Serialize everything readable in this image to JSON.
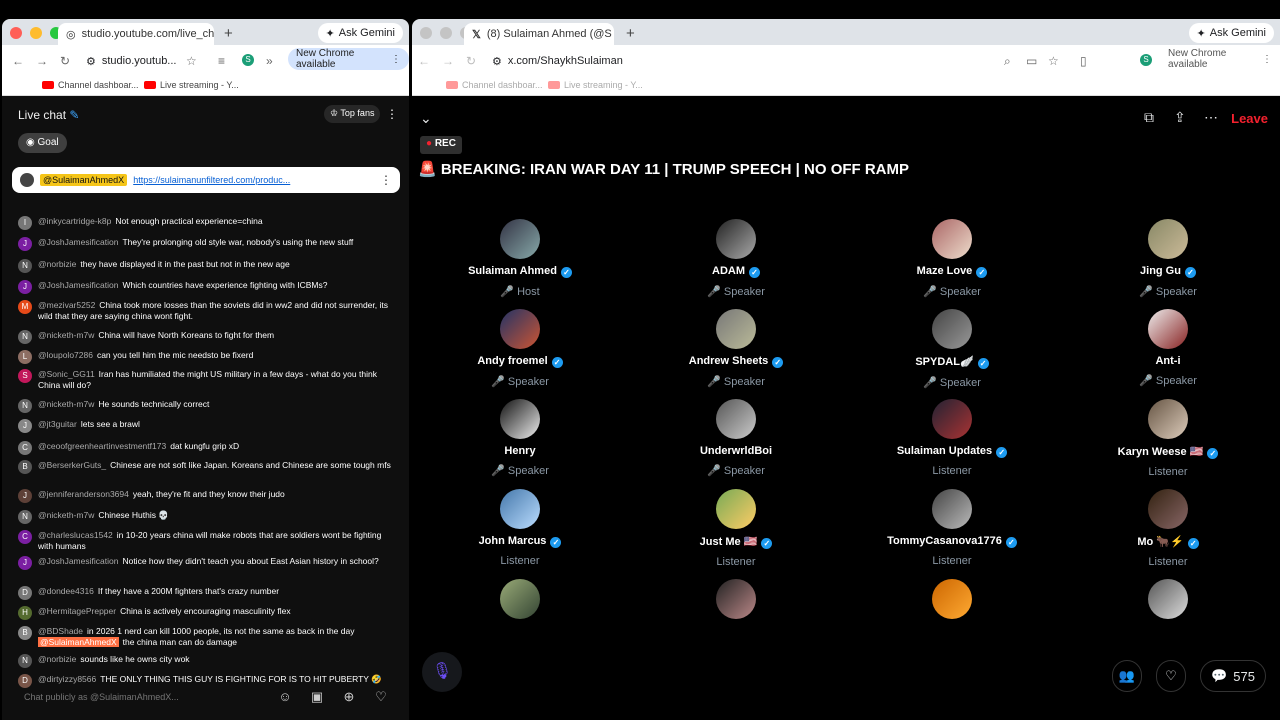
{
  "left": {
    "tab_title": "studio.youtube.com/live_chat",
    "url": "studio.youtub...",
    "ask_gemini": "Ask Gemini",
    "new_chrome": "New Chrome available",
    "bookmarks": [
      "Channel dashboar...",
      "Live streaming - Y..."
    ],
    "chat_title": "Live chat",
    "top_fans": "Top fans",
    "goal": "Goal",
    "pinned_user": "@SulaimanAhmedX",
    "pinned_link": "https://sulaimanunfiltered.com/produc...",
    "messages": [
      {
        "a": "@inkycartridge-k8p",
        "t": "Not enough practical experience=china",
        "c": "#777"
      },
      {
        "a": "@JoshJamesification",
        "t": "They're prolonging old style war, nobody's using the new stuff",
        "c": "#7b1fa2"
      },
      {
        "a": "@norbizie",
        "t": "they have displayed it in the past but not in the new age",
        "c": "#555"
      },
      {
        "a": "@JoshJamesification",
        "t": "Which countries have experience fighting with ICBMs?",
        "c": "#7b1fa2"
      },
      {
        "a": "@mezivar5252",
        "t": "China took more losses than the soviets did in ww2 and did not surrender, its wild that they are saying china wont fight.",
        "c": "#e64a19"
      },
      {
        "a": "@nicketh-m7w",
        "t": "China will have North Koreans to fight for them",
        "c": "#666"
      },
      {
        "a": "@loupolo7286",
        "t": "can you tell him the mic needsto be fixerd",
        "c": "#8d6e63"
      },
      {
        "a": "@Sonic_GG11",
        "t": "Iran has humiliated the might US military in a few days - what do you think China will do?",
        "c": "#c2185b"
      },
      {
        "a": "@nicketh-m7w",
        "t": "He sounds technically correct",
        "c": "#666"
      },
      {
        "a": "@jt3guitar",
        "t": "lets see a brawl",
        "c": "#888"
      },
      {
        "a": "@ceoofgreenheartinvestmentf173",
        "t": "dat kungfu grip xD",
        "c": "#777"
      },
      {
        "a": "@BerserkerGuts_",
        "t": "Chinese are not soft like Japan. Koreans and Chinese are some tough mfs",
        "c": "#555"
      },
      {
        "a": "@jenniferanderson3694",
        "t": "yeah, they're fit and they know their judo",
        "c": "#5d4037"
      },
      {
        "a": "@nicketh-m7w",
        "t": "Chinese Huthis 💀",
        "c": "#666"
      },
      {
        "a": "@charleslucas1542",
        "t": "in 10-20 years china will make robots that are soldiers wont be fighting with humans",
        "c": "#7b1fa2"
      },
      {
        "a": "@JoshJamesification",
        "t": "Notice how they didn't teach you about East Asian history in school?",
        "c": "#7b1fa2"
      },
      {
        "a": "@dondee4316",
        "t": "If they have a 200M fighters that's crazy number",
        "c": "#777"
      },
      {
        "a": "@HermitagePrepper",
        "t": "China is actively encouraging masculinity flex",
        "c": "#556b2f"
      },
      {
        "a": "@BDShade",
        "t": "in 2026 1 nerd can kill 1000 people, its not the same as back in the day",
        "t2": "the china man can do damage",
        "mention": "@SulaimanAhmedX",
        "c": "#888"
      },
      {
        "a": "@norbizie",
        "t": "sounds like he owns city wok",
        "c": "#555"
      },
      {
        "a": "@dirtyizzy8566",
        "t": "THE ONLY THING THIS GUY IS FIGHTING FOR IS TO HIT PUBERTY 🤣",
        "c": "#795548"
      }
    ],
    "chat_placeholder": "Chat publicly as @SulaimanAhmedX..."
  },
  "right": {
    "tab_title": "(8) Sulaiman Ahmed (@S",
    "url": "x.com/ShaykhSulaiman",
    "ask_gemini": "Ask Gemini",
    "new_chrome": "New Chrome available",
    "bookmarks": [
      "Channel dashboar...",
      "Live streaming - Y..."
    ],
    "rec": "REC",
    "leave": "Leave",
    "title": "🚨 BREAKING: IRAN WAR DAY 11 | TRUMP SPEECH | NO OFF RAMP",
    "people": [
      {
        "n": "Sulaiman Ahmed",
        "r": "Host",
        "v": true
      },
      {
        "n": "ADAM",
        "r": "Speaker",
        "v": true
      },
      {
        "n": "Maze Love",
        "r": "Speaker",
        "v": true
      },
      {
        "n": "Jing Gu",
        "r": "Speaker",
        "v": true
      },
      {
        "n": "Andy froemel",
        "r": "Speaker",
        "v": true
      },
      {
        "n": "Andrew Sheets",
        "r": "Speaker",
        "v": true
      },
      {
        "n": "SPYDAL🪽",
        "r": "Speaker",
        "v": true
      },
      {
        "n": "Ant-i",
        "r": "Speaker",
        "v": false
      },
      {
        "n": "Henry",
        "r": "Speaker",
        "v": false
      },
      {
        "n": "UnderwrldBoi",
        "r": "Speaker",
        "v": false
      },
      {
        "n": "Sulaiman Updates",
        "r": "Listener",
        "v": true
      },
      {
        "n": "Karyn Weese 🇺🇸",
        "r": "Listener",
        "v": true
      },
      {
        "n": "John Marcus",
        "r": "Listener",
        "v": true
      },
      {
        "n": "Just Me 🇺🇸",
        "r": "Listener",
        "v": true
      },
      {
        "n": "TommyCasanova1776",
        "r": "Listener",
        "v": true
      },
      {
        "n": "Mo 🐂⚡",
        "r": "Listener",
        "v": true
      },
      {
        "n": "",
        "r": "",
        "v": false
      },
      {
        "n": "",
        "r": "",
        "v": false
      },
      {
        "n": "",
        "r": "",
        "v": false
      },
      {
        "n": "",
        "r": "",
        "v": false
      }
    ],
    "comment_count": "575"
  }
}
